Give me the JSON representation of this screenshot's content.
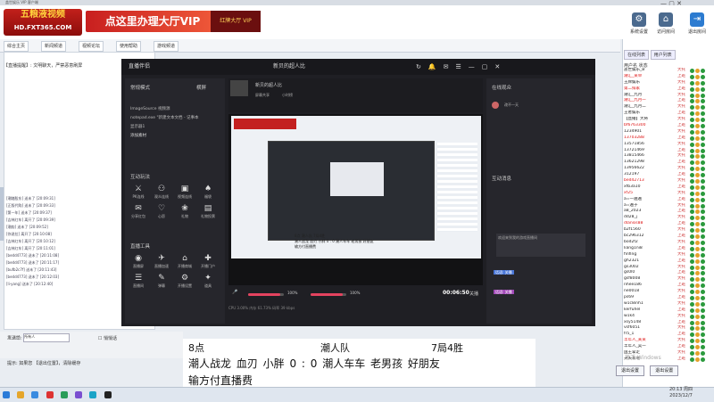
{
  "window": {
    "title": "盖世娱乐 VIP 客户端"
  },
  "banner": {
    "logo_text": "五粮液视频",
    "logo_sub": "HD.FXT365.COM",
    "vip_text": "点这里办理大厅VIP",
    "vip2_text": "红牌大厅 VIP",
    "buttons": [
      {
        "label": "系统设置"
      },
      {
        "label": "访问房间"
      },
      {
        "label": "收回卡"
      },
      {
        "label": "退出房间"
      }
    ]
  },
  "tabs": [
    "综合主页",
    "新闻频道",
    "视频论坛",
    "使用帮助",
    "游戏频道"
  ],
  "chat": {
    "top_message": "【直播提醒】: 文明聊天，严禁恶意刷屏",
    "messages": [
      "[潮踏股东] 送未了 [20:09:31]",
      "[正版代购] 送未了 [20:09:33]",
      "[第一年] 送未了 [20:09:37]",
      "[吉林红车] 离开了 [20:09:39]",
      "[潮韵] 送未了 [20:09:52]",
      "[你说拉] 离开了 [20:10:08]",
      "[吉林红车] 离开了 [20:10:12]",
      "[吉林红车] 离开了 [20:11:01]",
      "[bedd4773] 送未了 [20:11:08]",
      "[bedd4773] 送未了 [20:11:17]",
      "[bufb2c7f] 送未了 [20:11:43]",
      "[bedd4773] 送未了 [20:12:03]",
      "[li-yang] 送未了 [20:12:40]"
    ],
    "input_label": "发送给:",
    "input_value": "所有人",
    "checkbox_label": "悄悄话",
    "hint": "提示: 如果您 【退出位置】，清除缓存"
  },
  "right": {
    "tabs": [
      "在线列表",
      "用户列表"
    ],
    "header": "用户名  状态",
    "users": [
      {
        "name": "盖世娱乐_B",
        "status": "大托",
        "red": false
      },
      {
        "name": "潮汇_某单",
        "status": "上班",
        "red": true
      },
      {
        "name": "王牌娱乐",
        "status": "大托",
        "red": false
      },
      {
        "name": "第二排家",
        "status": "上班",
        "red": true
      },
      {
        "name": "潮汇_九月",
        "status": "大托",
        "red": false
      },
      {
        "name": "潮汇_九月一",
        "status": "上班",
        "red": true
      },
      {
        "name": "潮汇_九月二",
        "status": "大托",
        "red": false
      },
      {
        "name": "王者娱乐",
        "status": "上班",
        "red": false
      },
      {
        "name": "【直播】大将",
        "status": "大托",
        "red": false
      },
      {
        "name": "bf6763300",
        "status": "上班",
        "red": true
      },
      {
        "name": "1234901",
        "status": "大托",
        "red": false
      },
      {
        "name": "13703288",
        "status": "上班",
        "red": true
      },
      {
        "name": "13571856",
        "status": "大托",
        "red": false
      },
      {
        "name": "13721469",
        "status": "上班",
        "red": false
      },
      {
        "name": "13815466",
        "status": "大托",
        "red": false
      },
      {
        "name": "13621298",
        "status": "上班",
        "red": false
      },
      {
        "name": "13956622",
        "status": "大托",
        "red": false
      },
      {
        "name": "312197",
        "status": "上班",
        "red": false
      },
      {
        "name": "bed42713",
        "status": "大托",
        "red": true
      },
      {
        "name": "xfb3a10",
        "status": "上班",
        "red": false
      },
      {
        "name": "xf25",
        "status": "大托",
        "red": true
      },
      {
        "name": "a=一遍遍",
        "status": "上班",
        "red": false
      },
      {
        "name": "a=遍子",
        "status": "大托",
        "red": false
      },
      {
        "name": "a8_2023",
        "status": "上班",
        "red": false
      },
      {
        "name": "dd28_j",
        "status": "大托",
        "red": false
      },
      {
        "name": "dlansis88",
        "status": "上班",
        "red": true
      },
      {
        "name": "b2f1560",
        "status": "大托",
        "red": false
      },
      {
        "name": "bc296312",
        "status": "上班",
        "red": false
      },
      {
        "name": "bod2f2",
        "status": "大托",
        "red": false
      },
      {
        "name": "liang1ni8",
        "status": "上班",
        "red": false
      },
      {
        "name": "finfing",
        "status": "大托",
        "red": false
      },
      {
        "name": "gh2321",
        "status": "上班",
        "red": false
      },
      {
        "name": "gs3002",
        "status": "大托",
        "red": false
      },
      {
        "name": "gs0l0",
        "status": "上班",
        "red": false
      },
      {
        "name": "gsf8008",
        "status": "大托",
        "red": false
      },
      {
        "name": "nhee186",
        "status": "上班",
        "red": false
      },
      {
        "name": "ne0018",
        "status": "大托",
        "red": false
      },
      {
        "name": "ps69",
        "status": "上班",
        "red": false
      },
      {
        "name": "w1c8inh1",
        "status": "大托",
        "red": false
      },
      {
        "name": "kerfuhel",
        "status": "上班",
        "red": false
      },
      {
        "name": "w1k4",
        "status": "大托",
        "red": false
      },
      {
        "name": "xsy5148",
        "status": "上班",
        "red": false
      },
      {
        "name": "vsf6051",
        "status": "大托",
        "red": false
      },
      {
        "name": "fr5_1",
        "status": "上班",
        "red": false
      },
      {
        "name": "丰年人_某某",
        "status": "大托",
        "red": true
      },
      {
        "name": "丰年人_吴一",
        "status": "上班",
        "red": false
      },
      {
        "name": "国王拿走",
        "status": "大托",
        "red": false
      },
      {
        "name": "天天有地",
        "status": "上班",
        "red": false
      }
    ],
    "btn_a": "退出设置",
    "btn_b": "退出设置"
  },
  "obs": {
    "app_name": "直播伴侣",
    "title_center": "新贝的超人比",
    "scene_label": "常规模式",
    "scene_btn": "横屏",
    "sources_section": "添加素材",
    "sources": [
      "ImageSource 视频源",
      "notepad.exe \"新建文本文档 - 记事本",
      "显示器1"
    ],
    "interact_section": "互动玩法",
    "tools_section": "直播工具",
    "interact_items": [
      "PK连线",
      "观众连线",
      "视频连线",
      "福袋",
      "分享红包",
      "心愿",
      "礼物",
      "礼物投票"
    ],
    "tool_items": [
      "直播屏",
      "直播加速",
      "开播商城",
      "开播门户",
      "直播间",
      "弹幕",
      "开播设置",
      "道具"
    ],
    "preview_tabs": [
      "屏幕共享",
      "小时榜"
    ],
    "online_title": "在线观众",
    "online_user": "改不一天",
    "interact_msg_title": "互动消息",
    "msg_text": "欢迎来到我的游戏直播间",
    "time": "00:06:50",
    "end_btn": "关播",
    "volume1": "100%",
    "volume2": "100%",
    "status": "CPU 3.00%  内存 61.73%  码率 39 kbps",
    "overlay_lines": [
      "8点                    潮人队                 7局4胜",
      "潮人战龙 血刃 小胖  0 : 0  潮人车车 老男孩 好朋友",
      "输方付直播费"
    ],
    "pink_tags": [
      "话语: 关播",
      "话语: 关播"
    ]
  },
  "caption": {
    "line1_a": "8点",
    "line1_b": "潮人队",
    "line1_c": "7局4胜",
    "line2": "潮人战龙   血刃   小胖     0  :  0     潮人车车   老男孩     好朋友",
    "line3": "输方付直播费"
  },
  "taskbar": {
    "time": "20:13 周四",
    "date": "2023/12/7"
  },
  "watermark": "激活 Windows"
}
